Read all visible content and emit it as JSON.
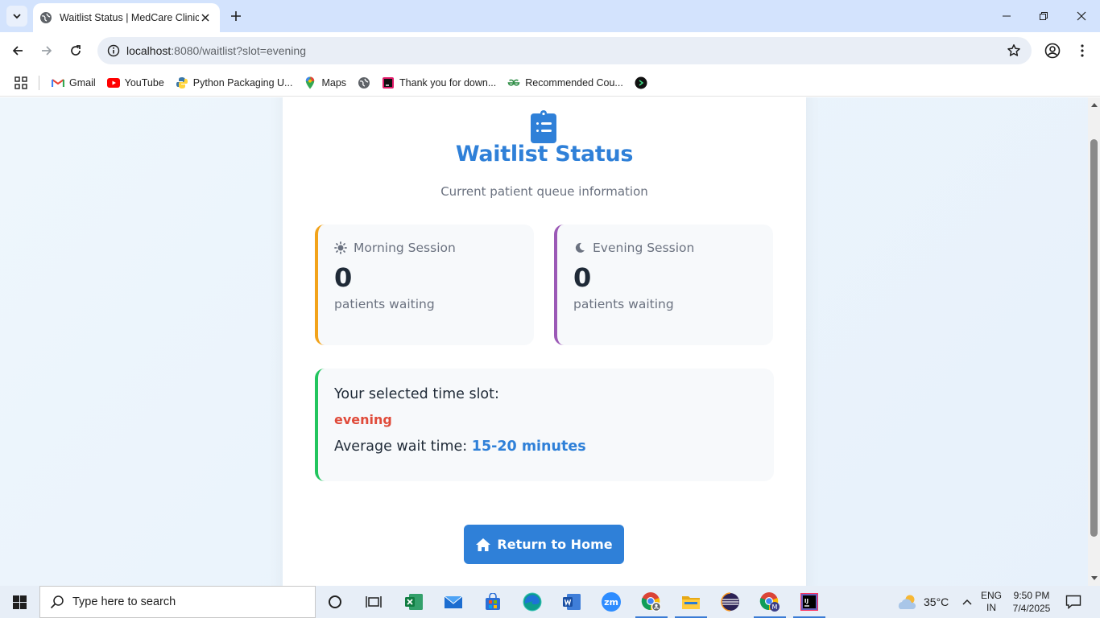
{
  "browser": {
    "tab_title": "Waitlist Status | MedCare Clinic",
    "url_host": "localhost",
    "url_path": ":8080/waitlist?slot=evening",
    "bookmarks": [
      {
        "label": "Gmail",
        "icon": "gmail-icon"
      },
      {
        "label": "YouTube",
        "icon": "youtube-icon"
      },
      {
        "label": "Python Packaging U...",
        "icon": "python-icon"
      },
      {
        "label": "Maps",
        "icon": "maps-icon"
      },
      {
        "label": "",
        "icon": "globe-icon"
      },
      {
        "label": "Thank you for down...",
        "icon": "download-site-icon"
      },
      {
        "label": "Recommended Cou...",
        "icon": "gfg-icon"
      },
      {
        "label": "",
        "icon": "dark-circle-icon"
      }
    ]
  },
  "page": {
    "title": "Waitlist Status",
    "subtitle": "Current patient queue information",
    "morning": {
      "label": "Morning Session",
      "count": "0",
      "unit": "patients waiting",
      "accent": "#f2a31b"
    },
    "evening": {
      "label": "Evening Session",
      "count": "0",
      "unit": "patients waiting",
      "accent": "#9b59b6"
    },
    "slot": {
      "label": "Your selected time slot:",
      "value": "evening",
      "wait_label": "Average wait time:",
      "wait_value": "15-20 minutes",
      "accent": "#22c55e"
    },
    "home_button": "Return to Home",
    "brand_color": "#2f80d8"
  },
  "taskbar": {
    "search_placeholder": "Type here to search",
    "weather": "35°C",
    "lang_top": "ENG",
    "lang_bottom": "IN",
    "time": "9:50 PM",
    "date": "7/4/2025"
  }
}
